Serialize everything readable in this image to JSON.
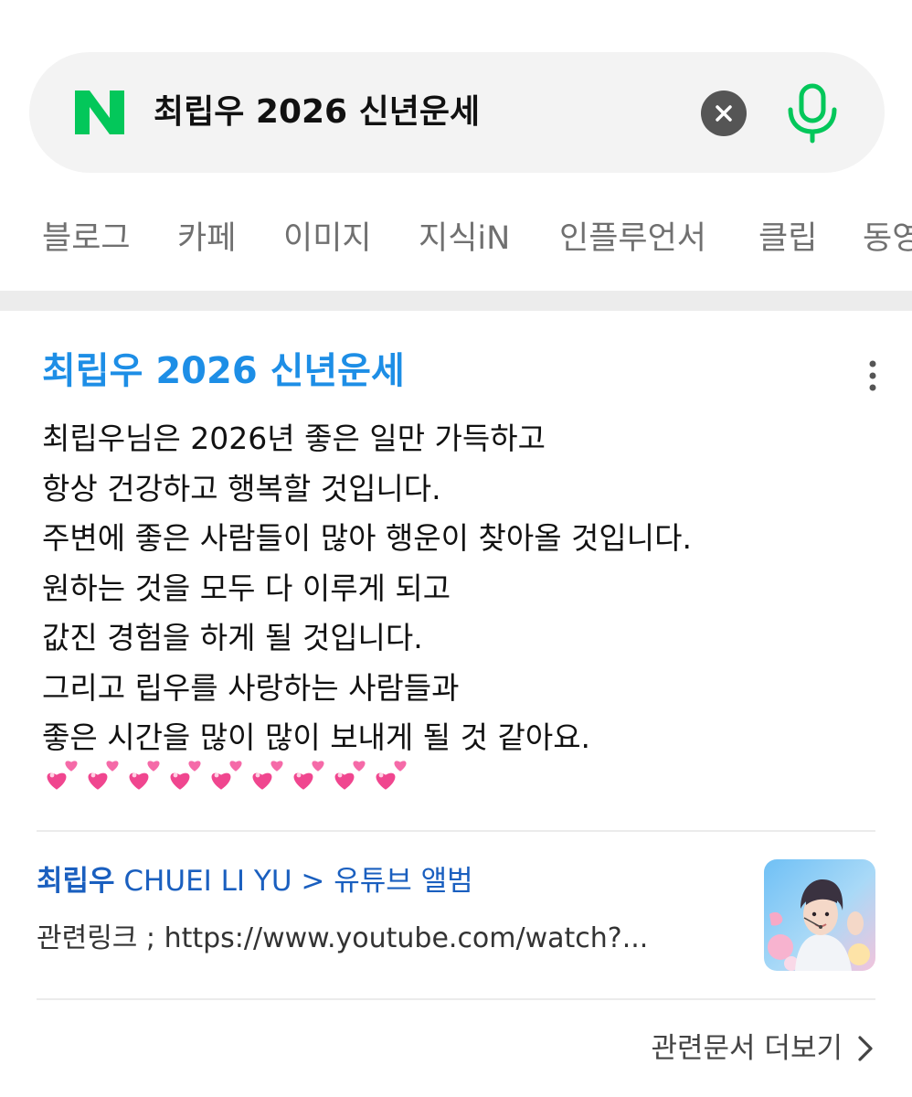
{
  "search": {
    "query": "최립우 2026 신년운세",
    "logo_letter": "N",
    "brand_color": "#03c75a"
  },
  "tabs": [
    {
      "label": "블로그"
    },
    {
      "label": "카페"
    },
    {
      "label": "이미지"
    },
    {
      "label": "지식iN"
    },
    {
      "label": "인플루언서"
    },
    {
      "label": "클립"
    },
    {
      "label": "동영상"
    }
  ],
  "result": {
    "title": "최립우 2026 신년운세",
    "title_color": "#1d8ee6",
    "lines": [
      "최립우님은 2026년 좋은 일만 가득하고",
      "항상 건강하고 행복할 것입니다.",
      "주변에 좋은 사람들이 많아 행운이 찾아올 것입니다.",
      "원하는 것을 모두 다 이루게 되고",
      "값진 경험을 하게 될 것입니다.",
      "그리고 립우를 사랑하는 사람들과",
      "좋은 시간을 많이 많이 보내게 될 것 같아요."
    ],
    "hearts_count": 9,
    "heart_icon": "two-hearts-emoji"
  },
  "link": {
    "title_bold": "최립우",
    "title_rest": " CHUEI LI YU > 유튜브 앨범",
    "description": "관련링크 ; https://www.youtube.com/watch?...",
    "color": "#1a5fbf"
  },
  "more_docs": {
    "label": "관련문서 더보기"
  }
}
